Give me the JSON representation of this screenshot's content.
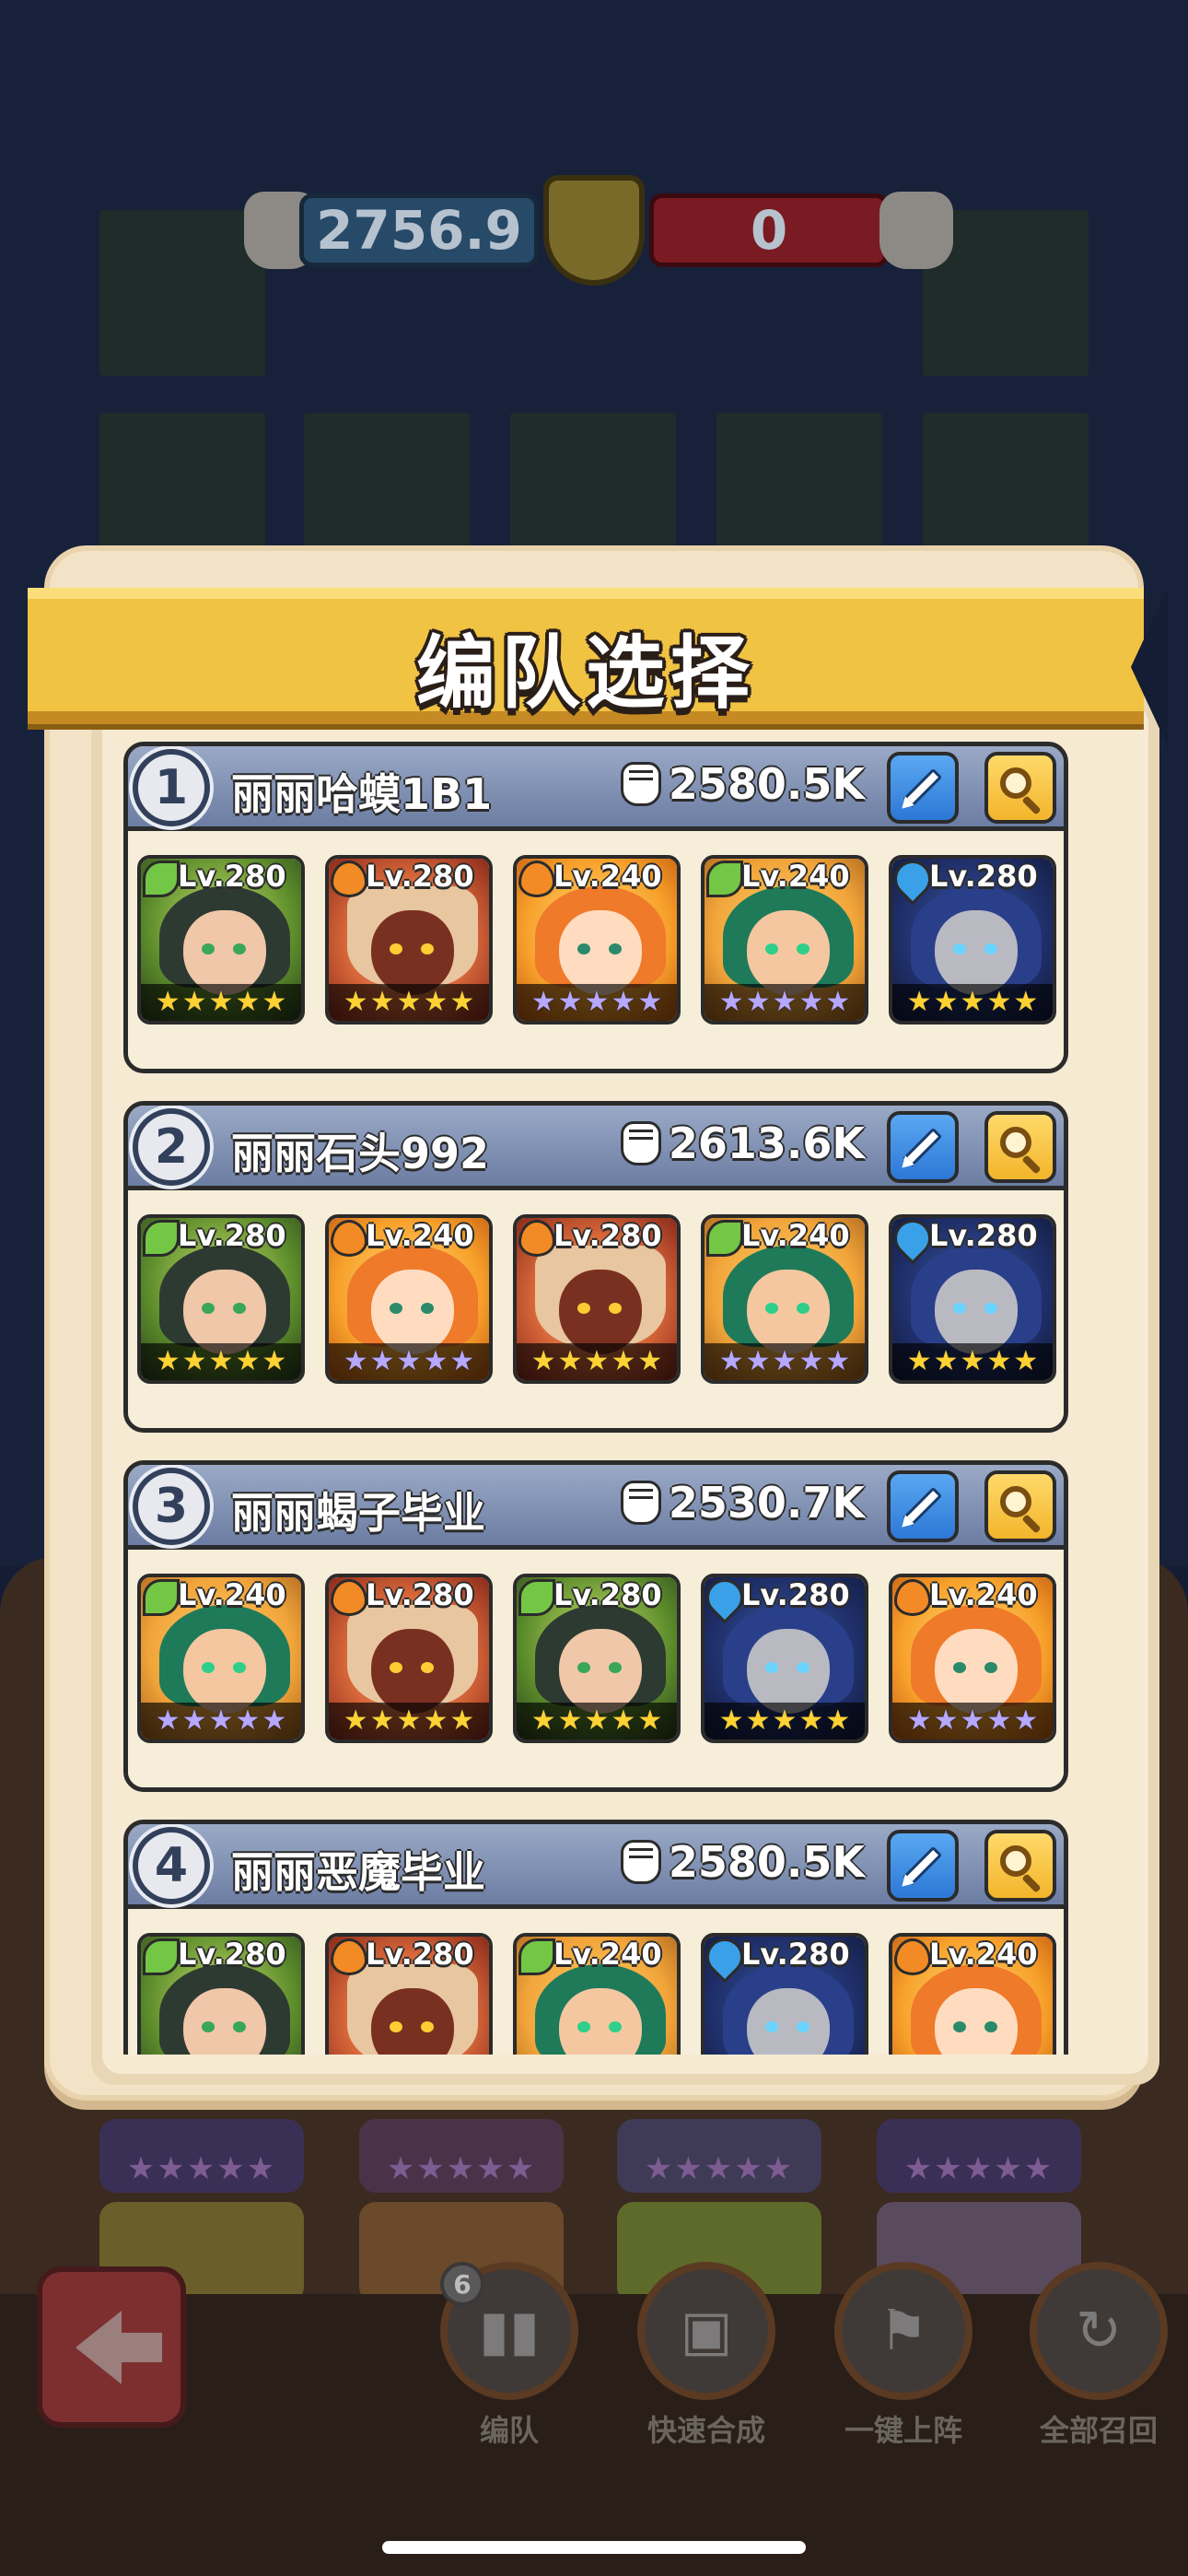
{
  "colors": {
    "ribbon": "#f1c343",
    "modal_bg": "#f3e3c6",
    "team_header": "#7c8cb0",
    "edit_button": "#3a8de4",
    "search_button": "#f6c13c",
    "gold_star": "#ffd233",
    "purple_star": "#b6a7ff"
  },
  "battle": {
    "left_power": "2756.9",
    "right_power": "0",
    "bg_badges": [
      "5",
      "5",
      "3"
    ]
  },
  "modal": {
    "title": "编队选择"
  },
  "teams": [
    {
      "number": "1",
      "name": "丽丽哈蟆1B1",
      "power": "2580.5K",
      "heroes": [
        {
          "theme": "t-leaf-dryad",
          "element": "leaf",
          "level": "Lv.280",
          "star_color": "gold"
        },
        {
          "theme": "t-fire-golem",
          "element": "fire",
          "level": "Lv.280",
          "star_color": "gold"
        },
        {
          "theme": "t-fire-kid",
          "element": "fire",
          "level": "Lv.240",
          "star_color": "purple"
        },
        {
          "theme": "t-leaf-pirate",
          "element": "leaf",
          "level": "Lv.240",
          "star_color": "purple"
        },
        {
          "theme": "t-water-beast",
          "element": "water",
          "level": "Lv.280",
          "star_color": "gold"
        }
      ]
    },
    {
      "number": "2",
      "name": "丽丽石头992",
      "power": "2613.6K",
      "heroes": [
        {
          "theme": "t-leaf-dryad",
          "element": "leaf",
          "level": "Lv.280",
          "star_color": "gold"
        },
        {
          "theme": "t-fire-kid",
          "element": "fire",
          "level": "Lv.240",
          "star_color": "purple"
        },
        {
          "theme": "t-fire-golem",
          "element": "fire",
          "level": "Lv.280",
          "star_color": "gold"
        },
        {
          "theme": "t-leaf-pirate",
          "element": "leaf",
          "level": "Lv.240",
          "star_color": "purple"
        },
        {
          "theme": "t-water-beast",
          "element": "water",
          "level": "Lv.280",
          "star_color": "gold"
        }
      ]
    },
    {
      "number": "3",
      "name": "丽丽蝎子毕业",
      "power": "2530.7K",
      "heroes": [
        {
          "theme": "t-leaf-pirate",
          "element": "leaf",
          "level": "Lv.240",
          "star_color": "purple"
        },
        {
          "theme": "t-fire-golem",
          "element": "fire",
          "level": "Lv.280",
          "star_color": "gold"
        },
        {
          "theme": "t-leaf-dryad",
          "element": "leaf",
          "level": "Lv.280",
          "star_color": "gold"
        },
        {
          "theme": "t-water-beast",
          "element": "water",
          "level": "Lv.280",
          "star_color": "gold"
        },
        {
          "theme": "t-fire-kid",
          "element": "fire",
          "level": "Lv.240",
          "star_color": "purple"
        }
      ]
    },
    {
      "number": "4",
      "name": "丽丽恶魔毕业",
      "power": "2580.5K",
      "heroes": [
        {
          "theme": "t-leaf-dryad",
          "element": "leaf",
          "level": "Lv.280",
          "star_color": "gold"
        },
        {
          "theme": "t-fire-golem",
          "element": "fire",
          "level": "Lv.280",
          "star_color": "gold"
        },
        {
          "theme": "t-leaf-pirate",
          "element": "leaf",
          "level": "Lv.240",
          "star_color": "purple"
        },
        {
          "theme": "t-water-beast",
          "element": "water",
          "level": "Lv.280",
          "star_color": "gold"
        },
        {
          "theme": "t-fire-kid",
          "element": "fire",
          "level": "Lv.240",
          "star_color": "purple"
        }
      ]
    }
  ],
  "bottom_bar": {
    "formation_count": "6",
    "formation_label": "编队",
    "quick_merge_label": "快速合成",
    "one_click_label": "一键上阵",
    "recall_all_label": "全部召回"
  },
  "icons": {
    "back": "back-arrow-icon",
    "edit": "pencil-icon",
    "search": "magnifier-icon",
    "power": "fist-icon"
  }
}
